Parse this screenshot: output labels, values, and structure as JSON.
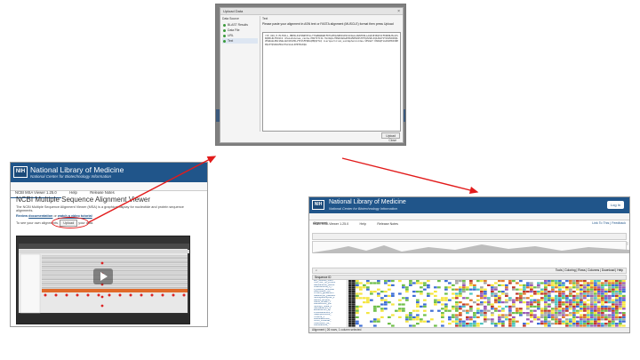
{
  "dialog": {
    "title": "Upload Data",
    "source_header": "Data Source",
    "text_header": "Text",
    "sources": [
      {
        "label": "BLAST Results"
      },
      {
        "label": "Data File"
      },
      {
        "label": "URL"
      },
      {
        "label": "Text"
      }
    ],
    "instruction": "Please paste your alignment in ASN text or FASTA alignment (MUSCLE) format then press Upload",
    "sequence_text": ">YP_026_H.MLTKILL_MNHSLKIVVNNYKYLLTTGWNGNGNIFDTGVEQLNPKAVDVIAVAGLLRGNTDDLLAAQSEIKQIVIFKDDNLMLAISKQKDLRLTKGVIA >Pseudomonas_zanha-PKUTSTCIA HLIAQLLTRNAVAKGAEPAVNPSRISTPTQVGSDLIQIAKAYVTVGDVPAKQLVPGRAGLERLVNGLQAYAPLEKLVTIVSFPQDLQMQQVTLQ >Lerquerinium_sundaphenioides-SESGGT KSRAQTLGVGIHEAVNHPQLPTQSSDLMRLIYGLSLGLIPRTDLKQA",
    "upload_label": "Upload",
    "close_label": "Close"
  },
  "left_page": {
    "logo": "NIH",
    "title": "National Library of Medicine",
    "subtitle": "National Center for Biotechnology Information",
    "nav": [
      "NCBI MSA Viewer 1.25.0",
      "Help",
      "Release Notes"
    ],
    "heading": "NCBI Multiple Sequence Alignment Viewer",
    "description": "The NCBI Multiple Sequence Alignment Viewer (MSA) is a graphical display for nucleotide and protein sequence alignments.",
    "review_prefix": "Review",
    "review_link": "documentation",
    "review_or": "or",
    "review_link2": "watch a video tutorial",
    "upload_prefix": "To see your own alignments,",
    "upload_button": "Upload",
    "upload_suffix": "your data.",
    "video_progress": 0.05
  },
  "right_page": {
    "logo": "NIH",
    "title": "National Library of Medicine",
    "subtitle": "National Center for Biotechnology Information",
    "login": "Log In",
    "nav": [
      "NCBI MSA Viewer 1.25.0",
      "Help",
      "Release Notes"
    ],
    "section": "Alignment",
    "link_feedback": "Link To This | Feedback",
    "toolbar_right": "Tools | Coloring | Rows | Columns | Download | Help",
    "seq_header": "Sequence ID",
    "seq_names": [
      "WP_029545_nnbh",
      "Tom_WP_hy_ynmeS",
      "Bacillaceous_parthe",
      "Gracilisinocia_n_r",
      "Pyrolobus_anthocal",
      "Desmodium_uni",
      "Ornitho_gentamicin",
      "Glaucocyst_pseudon",
      "Sphingobiumyces_s",
      "Bacilla_perpetu_",
      "Giardi_lindiam_f",
      "Lactococcus_lysi",
      "Sphingo_reikia_s",
      "Geobacterium_b",
      "Eubacterium_sp",
      "Photobacterium_s",
      "Staphylococcus_",
      "Yersinia_s",
      "Bifidobacterium_",
      "Vibrio_cholerae_",
      "Clostridium_sp_",
      "Lactobacillus_",
      "Cumulidium_thu",
      "Aeromonas_sp_",
      "Rhodobacter_",
      "Pseudomonas_"
    ],
    "footer": "Alignment | 26 rows, 1 column selected"
  },
  "colors": {
    "nih_blue": "#20558a",
    "arrow_red": "#e21b1b",
    "residue_palette": [
      "#f5e642",
      "#6fbf4a",
      "#3f6fd6",
      "#e07a2a",
      "#9b59b6",
      "#4ec5c1",
      "#c0392b",
      "#a6a6a6"
    ]
  }
}
